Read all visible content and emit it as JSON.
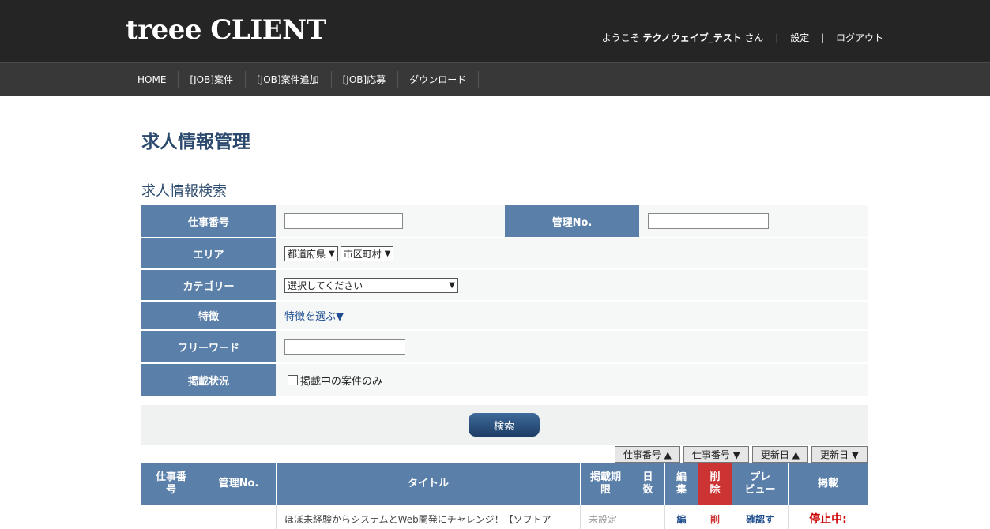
{
  "header": {
    "logo": "treee CLIENT",
    "welcome_prefix": "ようこそ",
    "user_name": "テクノウェイブ_テスト",
    "welcome_suffix": "さん",
    "settings": "設定",
    "logout": "ログアウト"
  },
  "nav": [
    "HOME",
    "[JOB]案件",
    "[JOB]案件追加",
    "[JOB]応募",
    "ダウンロード"
  ],
  "page_title": "求人情報管理",
  "search": {
    "title": "求人情報検索",
    "job_number_label": "仕事番号",
    "manage_no_label": "管理No.",
    "area_label": "エリア",
    "prefecture": "都道府県",
    "city": "市区町村",
    "category_label": "カテゴリー",
    "category_value": "選択してください",
    "feature_label": "特徴",
    "feature_link": "特徴を選ぶ▼",
    "freeword_label": "フリーワード",
    "status_label": "掲載状況",
    "status_checkbox": "掲載中の案件のみ",
    "button": "検索"
  },
  "sort_buttons": [
    "仕事番号 ▲",
    "仕事番号 ▼",
    "更新日 ▲",
    "更新日 ▼"
  ],
  "table": {
    "headers": [
      "仕事番\n号",
      "管理No.",
      "タイトル",
      "掲載期\n限",
      "日\n数",
      "編\n集",
      "削\n除",
      "プレ\nビュー",
      "掲載"
    ],
    "row": {
      "title": "ほぼ未経験からシステムとWeb開発にチャレンジ！【ソフトア",
      "deadline": "未設定",
      "edit": "編",
      "delete": "削",
      "preview": "確認す",
      "status": "停止中:"
    }
  },
  "colors": {
    "header_bg": "#252525",
    "label_bg": "#5a7fa8",
    "title": "#2c4a6e",
    "delete": "#cc3333"
  }
}
